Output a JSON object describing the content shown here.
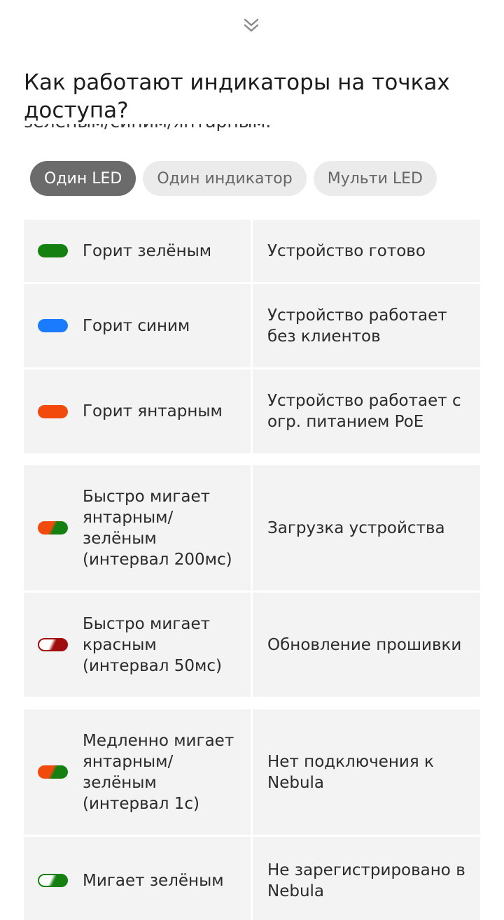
{
  "sheet": {
    "collapse_icon": "double-chevron-down-icon",
    "title": "Как работают индикаторы на точках доступа?",
    "clipped_text": "зелёным/синим/янтарным."
  },
  "tabs": [
    {
      "label": "Один LED",
      "active": true
    },
    {
      "label": "Один индикатор",
      "active": false
    },
    {
      "label": "Мульти LED",
      "active": false
    }
  ],
  "table": {
    "groups": [
      {
        "rows": [
          {
            "led": "solid-green",
            "label": "Горит зелёным",
            "meaning": "Устройство готово"
          },
          {
            "led": "solid-blue",
            "label": "Горит синим",
            "meaning": "Устройство работает без клиентов"
          },
          {
            "led": "solid-amber",
            "label": "Горит янтарным",
            "meaning": "Устройство работает с огр. питанием PoE"
          }
        ]
      },
      {
        "rows": [
          {
            "led": "amber-green",
            "label": "Быстро мигает янтарным/ зелёным (интервал 200мс)",
            "meaning": "Загрузка устройства"
          },
          {
            "led": "white-red",
            "label": "Быстро мигает красным (интервал 50мс)",
            "meaning": "Обновление прошивки"
          }
        ]
      },
      {
        "rows": [
          {
            "led": "amber-green",
            "label": "Медленно мигает янтарным/ зелёным (интервал 1с)",
            "meaning": "Нет подключения к Nebula"
          },
          {
            "led": "white-green",
            "label": "Мигает зелёным",
            "meaning": "Не зарегистрировано в Nebula"
          }
        ]
      }
    ]
  },
  "colors": {
    "green": "#14800f",
    "blue": "#1a7bff",
    "amber": "#f24a0c",
    "red": "#a10c0c",
    "tab_active_bg": "#6b6b6b",
    "tab_bg": "#ebebeb",
    "cell_bg": "#f3f3f3"
  }
}
